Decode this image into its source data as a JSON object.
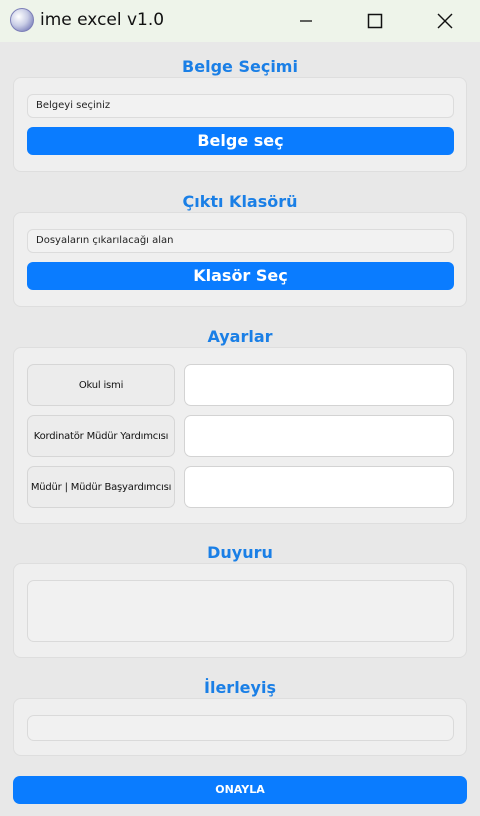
{
  "window": {
    "title": "ime excel v1.0",
    "icon": "app-logo-icon",
    "controls": [
      "minimize-icon",
      "maximize-icon",
      "close-icon"
    ]
  },
  "document_section": {
    "title": "Belge Seçimi",
    "field_text": "Belgeyi seçiniz",
    "button_label": "Belge seç"
  },
  "output_section": {
    "title": "Çıktı Klasörü",
    "field_text": "Dosyaların çıkarılacağı alan",
    "button_label": "Klasör Seç"
  },
  "settings_section": {
    "title": "Ayarlar",
    "rows": [
      {
        "label": "Okul ismi",
        "value": ""
      },
      {
        "label": "Kordinatör Müdür Yardımcısı",
        "value": ""
      },
      {
        "label": "Müdür | Müdür Başyardımcısı",
        "value": ""
      }
    ]
  },
  "notice_section": {
    "title": "Duyuru",
    "text": ""
  },
  "progress_section": {
    "title": "İlerleyiş",
    "progress": 0
  },
  "confirm_button": {
    "label": "ONAYLA"
  },
  "colors": {
    "accent": "#0a7cff",
    "section_title": "#1a7fe6",
    "background": "#e8e8e8",
    "titlebar": "#eef4ea"
  }
}
